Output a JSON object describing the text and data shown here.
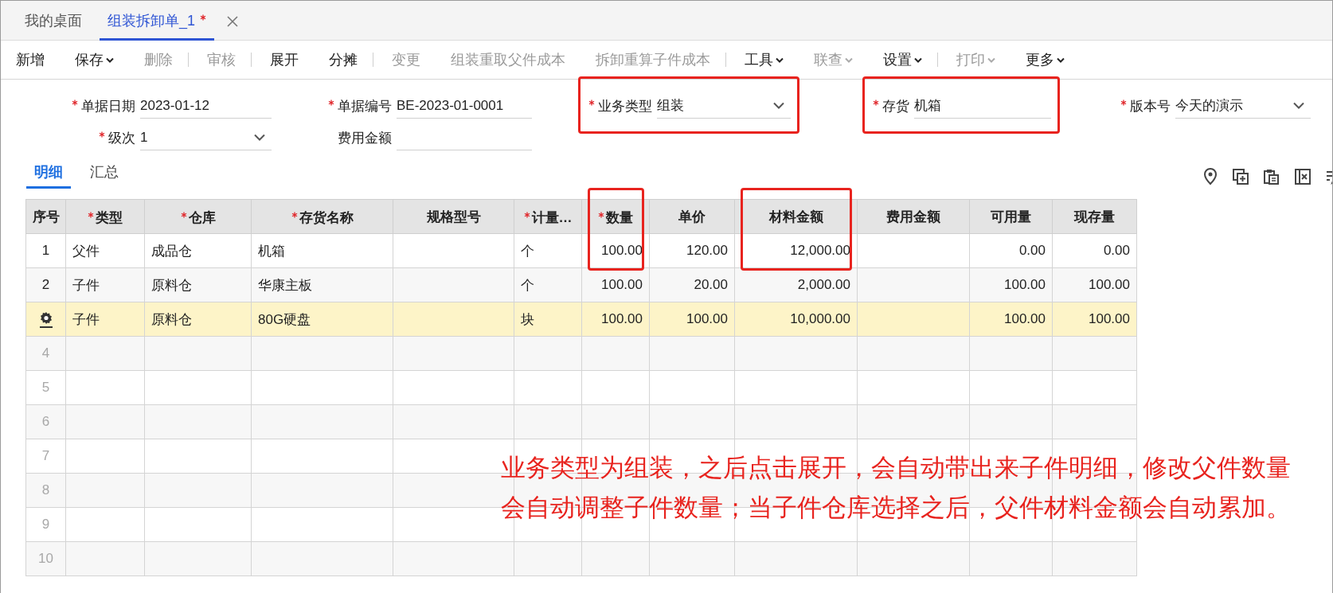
{
  "tabs": [
    {
      "label": "我的桌面",
      "selected": false,
      "modified": false,
      "closable": false
    },
    {
      "label": "组装拆卸单_1",
      "selected": true,
      "modified": true,
      "closable": true
    }
  ],
  "toolbar": [
    {
      "items": [
        {
          "label": "新增",
          "disabled": false,
          "dropdown": false
        },
        {
          "label": "保存",
          "disabled": false,
          "dropdown": true
        },
        {
          "label": "删除",
          "disabled": true,
          "dropdown": false
        }
      ]
    },
    {
      "items": [
        {
          "label": "审核",
          "disabled": true,
          "dropdown": false
        }
      ]
    },
    {
      "items": [
        {
          "label": "展开",
          "disabled": false,
          "dropdown": false
        },
        {
          "label": "分摊",
          "disabled": false,
          "dropdown": false
        }
      ]
    },
    {
      "items": [
        {
          "label": "变更",
          "disabled": true,
          "dropdown": false
        },
        {
          "label": "组装重取父件成本",
          "disabled": true,
          "dropdown": false
        },
        {
          "label": "拆卸重算子件成本",
          "disabled": true,
          "dropdown": false
        }
      ]
    },
    {
      "items": [
        {
          "label": "工具",
          "disabled": false,
          "dropdown": true
        },
        {
          "label": "联查",
          "disabled": true,
          "dropdown": true
        },
        {
          "label": "设置",
          "disabled": false,
          "dropdown": true
        }
      ]
    },
    {
      "items": [
        {
          "label": "打印",
          "disabled": true,
          "dropdown": true
        },
        {
          "label": "更多",
          "disabled": false,
          "dropdown": true
        }
      ]
    }
  ],
  "form": {
    "fields": [
      {
        "label": "单据日期",
        "required": true,
        "kind": "text",
        "value": "2023-01-12",
        "highlighted": false
      },
      {
        "label": "单据编号",
        "required": true,
        "kind": "text",
        "value": "BE-2023-01-0001",
        "highlighted": false
      },
      {
        "label": "业务类型",
        "required": true,
        "kind": "select",
        "value": "组装",
        "highlighted": true
      },
      {
        "label": "存货",
        "required": true,
        "kind": "text",
        "value": "机箱",
        "highlighted": true
      },
      {
        "label": "版本号",
        "required": true,
        "kind": "select",
        "value": "今天的演示",
        "highlighted": false
      },
      {
        "label": "级次",
        "required": true,
        "kind": "select",
        "value": "1",
        "highlighted": false
      },
      {
        "label": "费用金额",
        "required": false,
        "kind": "text",
        "highlighted": false
      }
    ]
  },
  "detail_tabs": [
    {
      "label": "明细",
      "selected": true
    },
    {
      "label": "汇总",
      "selected": false
    }
  ],
  "table": {
    "columns": [
      {
        "label": "序号",
        "required": false,
        "kind": "index",
        "highlighted": false
      },
      {
        "label": "类型",
        "required": true,
        "kind": "text",
        "highlighted": false
      },
      {
        "label": "仓库",
        "required": true,
        "kind": "text",
        "highlighted": false
      },
      {
        "label": "存货名称",
        "required": true,
        "kind": "text",
        "highlighted": false
      },
      {
        "label": "规格型号",
        "required": false,
        "kind": "text",
        "highlighted": false
      },
      {
        "label": "计量…",
        "required": true,
        "kind": "text",
        "highlighted": false
      },
      {
        "label": "数量",
        "required": true,
        "kind": "number",
        "highlighted": true
      },
      {
        "label": "单价",
        "required": false,
        "kind": "number",
        "highlighted": false
      },
      {
        "label": "材料金额",
        "required": false,
        "kind": "number",
        "highlighted": true
      },
      {
        "label": "费用金额",
        "required": false,
        "kind": "number",
        "highlighted": false
      },
      {
        "label": "可用量",
        "required": false,
        "kind": "number",
        "highlighted": false
      },
      {
        "label": "现存量",
        "required": false,
        "kind": "number",
        "highlighted": false
      }
    ],
    "rows": [
      {
        "seq": "1",
        "selected": false,
        "cells": [
          "父件",
          "成品仓",
          "机箱",
          null,
          "个",
          "100.00",
          "120.00",
          "12,000.00",
          null,
          "0.00",
          "0.00"
        ]
      },
      {
        "seq": "2",
        "selected": false,
        "cells": [
          "子件",
          "原料仓",
          "华康主板",
          null,
          "个",
          "100.00",
          "20.00",
          "2,000.00",
          null,
          "100.00",
          "100.00"
        ]
      },
      {
        "selected": true,
        "cells": [
          "子件",
          "原料仓",
          "80G硬盘",
          null,
          "块",
          "100.00",
          "100.00",
          "10,000.00",
          null,
          "100.00",
          "100.00"
        ]
      },
      {
        "seq": "4",
        "selected": false
      },
      {
        "seq": "5",
        "selected": false
      },
      {
        "seq": "6",
        "selected": false
      },
      {
        "seq": "7",
        "selected": false
      },
      {
        "seq": "8",
        "selected": false
      },
      {
        "seq": "9",
        "selected": false
      },
      {
        "seq": "10",
        "selected": false
      }
    ]
  },
  "annotation": {
    "lines": [
      "业务类型为组装，之后点击展开，会自动带出来子件明细，修改父件数量",
      "会自动调整子件数量；当子件仓库选择之后，父件材料金额会自动累加。"
    ]
  }
}
